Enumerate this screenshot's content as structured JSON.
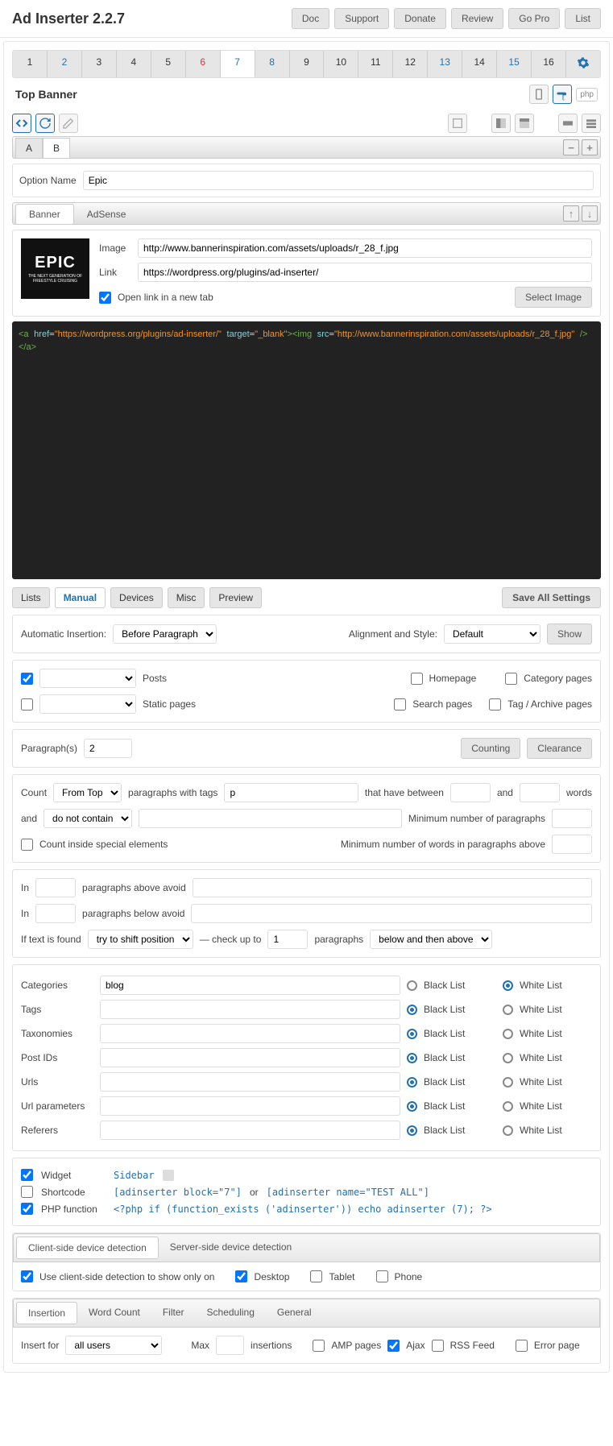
{
  "header": {
    "title": "Ad Inserter 2.2.7",
    "buttons": [
      "Doc",
      "Support",
      "Donate",
      "Review",
      "Go Pro",
      "List"
    ]
  },
  "blockTabs": [
    "1",
    "2",
    "3",
    "4",
    "5",
    "6",
    "7",
    "8",
    "9",
    "10",
    "11",
    "12",
    "13",
    "14",
    "15",
    "16"
  ],
  "activeTab": "7",
  "blueTabs": [
    "2",
    "7",
    "8",
    "13",
    "15"
  ],
  "redTabs": [
    "6"
  ],
  "blockTitle": "Top Banner",
  "phpBadge": "php",
  "abTabs": [
    "A",
    "B"
  ],
  "activeAb": "B",
  "optionName": {
    "label": "Option Name",
    "value": "Epic"
  },
  "bannerTabs": [
    "Banner",
    "AdSense"
  ],
  "activeBanner": "Banner",
  "banner": {
    "imageLabel": "Image",
    "imageValue": "http://www.bannerinspiration.com/assets/uploads/r_28_f.jpg",
    "linkLabel": "Link",
    "linkValue": "https://wordpress.org/plugins/ad-inserter/",
    "newTab": "Open link in a new tab",
    "newTabChecked": true,
    "selectImage": "Select Image",
    "preview": {
      "title": "EPIC",
      "sub": "THE NEXT GENERATION OF FREESTYLE CRUISING"
    }
  },
  "codeHtml": "<a href=\"https://wordpress.org/plugins/ad-inserter/\" target=\"_blank\"><img src=\"http://www.bannerinspiration.com/assets/uploads/r_28_f.jpg\" /></a>",
  "settingsTabs": [
    "Lists",
    "Manual",
    "Devices",
    "Misc",
    "Preview"
  ],
  "settingsActive": "Manual",
  "saveAll": "Save All Settings",
  "insertion": {
    "autoLabel": "Automatic Insertion:",
    "autoValue": "Before Paragraph",
    "alignLabel": "Alignment and Style:",
    "alignValue": "Default",
    "show": "Show"
  },
  "pages": {
    "postsChecked": true,
    "posts": "Posts",
    "static": "Static pages",
    "homepage": "Homepage",
    "search": "Search pages",
    "category": "Category pages",
    "tag": "Tag / Archive pages"
  },
  "paragraphs": {
    "label": "Paragraph(s)",
    "value": "2",
    "counting": "Counting",
    "clearance": "Clearance"
  },
  "count": {
    "countLabel": "Count",
    "fromTop": "From Top",
    "withTags": "paragraphs with tags",
    "tagValue": "p",
    "between": "that have between",
    "and": "and",
    "words": "words",
    "andLabel": "and",
    "contain": "do not contain",
    "minParas": "Minimum number of paragraphs",
    "countInside": "Count inside special elements",
    "minWords": "Minimum number of words in paragraphs above"
  },
  "avoid": {
    "in": "In",
    "aboveAvoid": "paragraphs above avoid",
    "belowAvoid": "paragraphs below avoid",
    "ifFound": "If text is found",
    "shift": "try to shift position",
    "checkUp": "— check up to",
    "checkValue": "1",
    "paragraphs": "paragraphs",
    "belowAbove": "below and then above"
  },
  "lists": {
    "rows": [
      {
        "label": "Categories",
        "value": "blog",
        "white": true
      },
      {
        "label": "Tags",
        "value": "",
        "white": false
      },
      {
        "label": "Taxonomies",
        "value": "",
        "white": false
      },
      {
        "label": "Post IDs",
        "value": "",
        "white": false
      },
      {
        "label": "Urls",
        "value": "",
        "white": false
      },
      {
        "label": "Url parameters",
        "value": "",
        "white": false
      },
      {
        "label": "Referers",
        "value": "",
        "white": false
      }
    ],
    "black": "Black List",
    "white": "White List"
  },
  "manual": {
    "widget": "Widget",
    "widgetCode": "Sidebar",
    "shortcode": "Shortcode",
    "shortcodeCode": "[adinserter block=\"7\"]",
    "or": "or",
    "shortcodeCode2": "[adinserter name=\"TEST ALL\"]",
    "php": "PHP function",
    "phpCode": "<?php if (function_exists ('adinserter')) echo adinserter (7); ?>"
  },
  "deviceTabs": [
    "Client-side device detection",
    "Server-side device detection"
  ],
  "deviceActive": "Client-side device detection",
  "devices": {
    "use": "Use client-side detection to show only on",
    "desktop": "Desktop",
    "tablet": "Tablet",
    "phone": "Phone"
  },
  "miscTabs": [
    "Insertion",
    "Word Count",
    "Filter",
    "Scheduling",
    "General"
  ],
  "miscActive": "Insertion",
  "misc": {
    "insertFor": "Insert for",
    "users": "all users",
    "max": "Max",
    "insertions": "insertions",
    "amp": "AMP pages",
    "ajax": "Ajax",
    "rss": "RSS Feed",
    "error": "Error page"
  }
}
